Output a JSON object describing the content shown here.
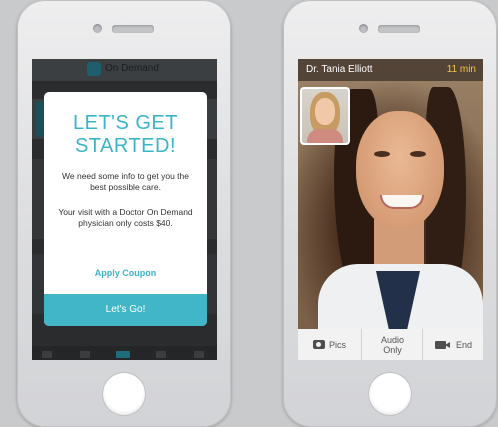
{
  "left_phone": {
    "app_bar": {
      "title": "On Demand"
    },
    "modal": {
      "title_line1": "LET'S GET",
      "title_line2": "STARTED!",
      "body1": "We need some info to get you the best possible care.",
      "body2": "Your visit with a Doctor On Demand physician only costs $40.",
      "coupon_link": "Apply Coupon",
      "primary_button": "Let's Go!"
    }
  },
  "right_phone": {
    "call_bar": {
      "doctor_name": "Dr. Tania Elliott",
      "duration": "11 min"
    },
    "controls": [
      {
        "label": "Pics",
        "icon": "camera-icon"
      },
      {
        "label_line1": "Audio",
        "label_line2": "Only"
      },
      {
        "label": "End",
        "icon": "video-camera-icon"
      }
    ]
  },
  "colors": {
    "accent": "#3ab5c8",
    "button": "#41b6c9",
    "timer": "#f4c642"
  }
}
